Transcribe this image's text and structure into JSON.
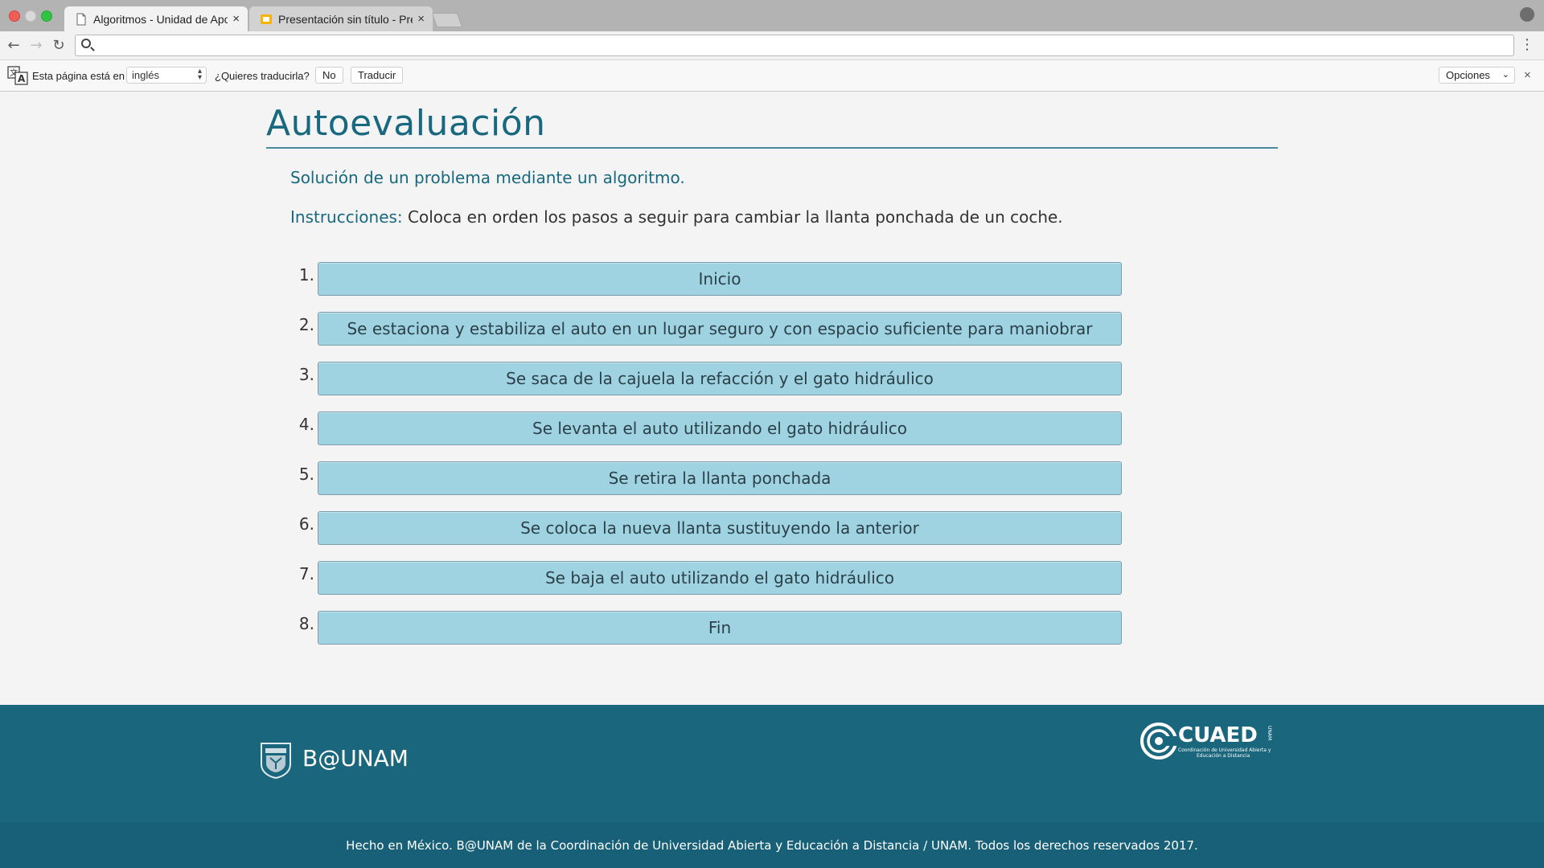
{
  "browser": {
    "tabs": [
      {
        "title": "Algoritmos - Unidad de Apoyo",
        "active": true
      },
      {
        "title": "Presentación sin título - Prese",
        "active": false
      }
    ],
    "close_glyph": "×",
    "address": ""
  },
  "translate_bar": {
    "prefix": "Esta página está en",
    "language": "inglés",
    "question": "¿Quieres traducirla?",
    "no_label": "No",
    "translate_label": "Traducir",
    "options_label": "Opciones",
    "close_glyph": "×"
  },
  "page": {
    "title": "Autoevaluación",
    "subtitle": "Solución de un problema mediante un algoritmo.",
    "instructions_label": "Instrucciones:",
    "instructions_text": " Coloca en orden los pasos a seguir para cambiar la llanta ponchada de un coche.",
    "steps": [
      {
        "num": "1.",
        "text": "Inicio"
      },
      {
        "num": "2.",
        "text": "Se estaciona y estabiliza el auto en un lugar seguro y con espacio suficiente para maniobrar"
      },
      {
        "num": "3.",
        "text": "Se saca de la cajuela la refacción y el gato hidráulico"
      },
      {
        "num": "4.",
        "text": "Se levanta el auto utilizando el gato hidráulico"
      },
      {
        "num": "5.",
        "text": "Se retira la llanta ponchada"
      },
      {
        "num": "6.",
        "text": "Se coloca la nueva llanta sustituyendo la anterior"
      },
      {
        "num": "7.",
        "text": "Se baja el auto utilizando el gato hidráulico"
      },
      {
        "num": "8.",
        "text": "Fin"
      }
    ]
  },
  "footer": {
    "brand": "B@UNAM",
    "cuaed_name": "CUAED",
    "cuaed_caption_1": "Coordinación de Universidad Abierta y",
    "cuaed_caption_2": "Educación a Distancia",
    "cuaed_side": "UNAM",
    "copyright": "Hecho en México. B@UNAM de la Coordinación de Universidad Abierta y Educación a Distancia / UNAM. Todos los derechos reservados 2017."
  },
  "colors": {
    "accent": "#18687f",
    "step_fill": "#9fd3e2",
    "footer": "#1a667c"
  },
  "icons": [
    "translate-icon",
    "back-icon",
    "forward-icon",
    "reload-icon",
    "search-icon",
    "menu-icon",
    "profile-icon",
    "page-icon",
    "slides-icon",
    "unam-shield-icon",
    "cuaed-logo"
  ]
}
